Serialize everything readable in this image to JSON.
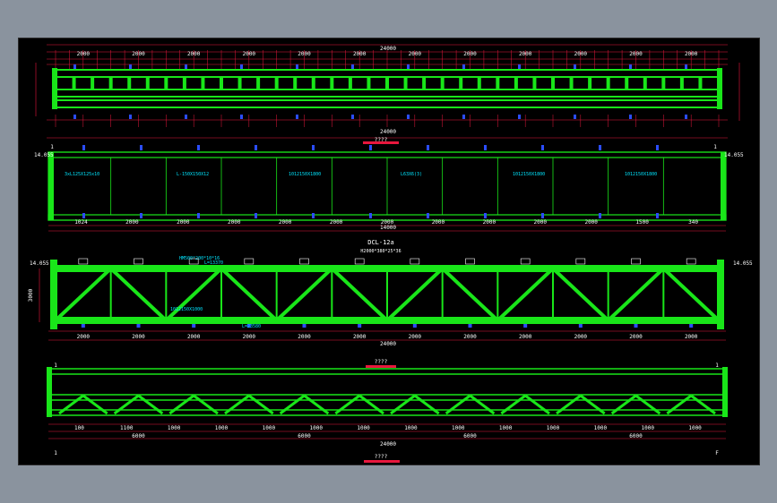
{
  "drawing": {
    "view1": {
      "total_dim": "24000",
      "top_dims": [
        "2000",
        "2000",
        "2000",
        "2000",
        "2000",
        "2000",
        "2000",
        "2000",
        "2000",
        "2000",
        "2000",
        "2000"
      ],
      "top_dims_ends": [
        "1024",
        "1500"
      ],
      "bottom_total_dim": "24000",
      "caption": "????",
      "left_labels": [
        "1",
        "A"
      ],
      "right_labels": [
        "1",
        "A"
      ]
    },
    "view2": {
      "left_elev": "14.055",
      "right_elev": "14.055",
      "bottom_dims": [
        "1024",
        "2000",
        "2000",
        "2000",
        "2000",
        "2000",
        "2000",
        "2000",
        "2000",
        "2000",
        "2000",
        "1500",
        "340"
      ],
      "bottom_total": "14000",
      "annotations": [
        "3xL125X125x10",
        "L-150X150X12",
        "1012150X1800",
        "L63X6(3)",
        "1012150X1800",
        "1012150X1800"
      ]
    },
    "view3": {
      "title": "DCL-12a",
      "subtitle": "H2000*380*25*36",
      "left_elev": "14.055",
      "right_elev": "14.055",
      "height_dim": "3000",
      "bottom_dims": [
        "2000",
        "2000",
        "2000",
        "2000",
        "2000",
        "2000",
        "2000",
        "2000",
        "2000",
        "2000",
        "2000",
        "2000"
      ],
      "total_dim": "24000",
      "caption": "????",
      "annotations": [
        "HM500*200*10*16",
        "L=13370",
        "1012150X1000",
        "L=23580"
      ]
    },
    "view4": {
      "left_mark": "1",
      "right_mark": "1",
      "bottom_dims_a": [
        "100",
        "1100",
        "1000",
        "1000",
        "1000",
        "1000",
        "1000",
        "1000",
        "1000",
        "1000",
        "1000",
        "1000",
        "1000",
        "1000"
      ],
      "bottom_dims_b": [
        "6000",
        "6000",
        "6000",
        "6000"
      ],
      "total_dim": "24000",
      "left_axis": "1",
      "right_axis": "F",
      "caption": "????"
    }
  },
  "colors": {
    "steel": "#19e619",
    "dimension": "#e8173d",
    "text": "#ffffff",
    "annotation": "#00e5ff",
    "marker": "#2b4dff",
    "background": "#000000"
  }
}
